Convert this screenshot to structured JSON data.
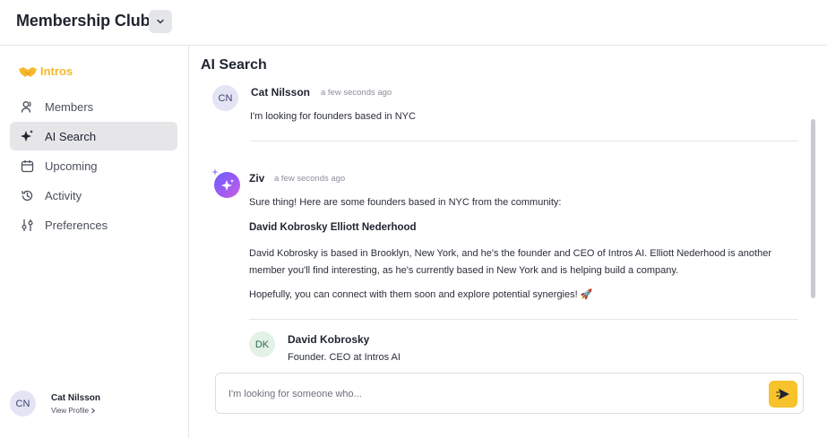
{
  "header": {
    "title": "Membership Club",
    "dropdown_icon": "chevron-down-icon"
  },
  "sidebar": {
    "brand": "Intros",
    "brand_color": "#f5b82e",
    "items": [
      {
        "label": "Members",
        "icon": "members-icon",
        "active": false
      },
      {
        "label": "AI Search",
        "icon": "sparkle-icon",
        "active": true
      },
      {
        "label": "Upcoming",
        "icon": "calendar-icon",
        "active": false
      },
      {
        "label": "Activity",
        "icon": "history-icon",
        "active": false
      },
      {
        "label": "Preferences",
        "icon": "sliders-icon",
        "active": false
      }
    ],
    "user": {
      "initials": "CN",
      "name": "Cat Nilsson",
      "link": "View Profile"
    }
  },
  "main": {
    "title": "AI Search",
    "messages": [
      {
        "initials": "CN",
        "sender": "Cat Nilsson",
        "time": "a few seconds ago",
        "text": "I'm looking for founders based in NYC"
      },
      {
        "sender": "Ziv",
        "time": "a few seconds ago",
        "intro": "Sure thing! Here are some founders based in NYC from the community:",
        "heading": "David Kobrosky Elliott Nederhood",
        "body": "David Kobrosky is based in Brooklyn, New York, and he's the founder and CEO of Intros AI. Elliott Nederhood is another member you'll find interesting, as he's currently based in New York and is helping build a company.",
        "closing": "Hopefully, you can connect with them soon and explore potential synergies! 🚀"
      }
    ],
    "profile_card": {
      "initials": "DK",
      "name": "David Kobrosky",
      "role": "Founder, CEO at Intros AI"
    },
    "composer": {
      "placeholder": "I'm looking for someone who...",
      "value": ""
    },
    "accent": "#f7c22a"
  }
}
